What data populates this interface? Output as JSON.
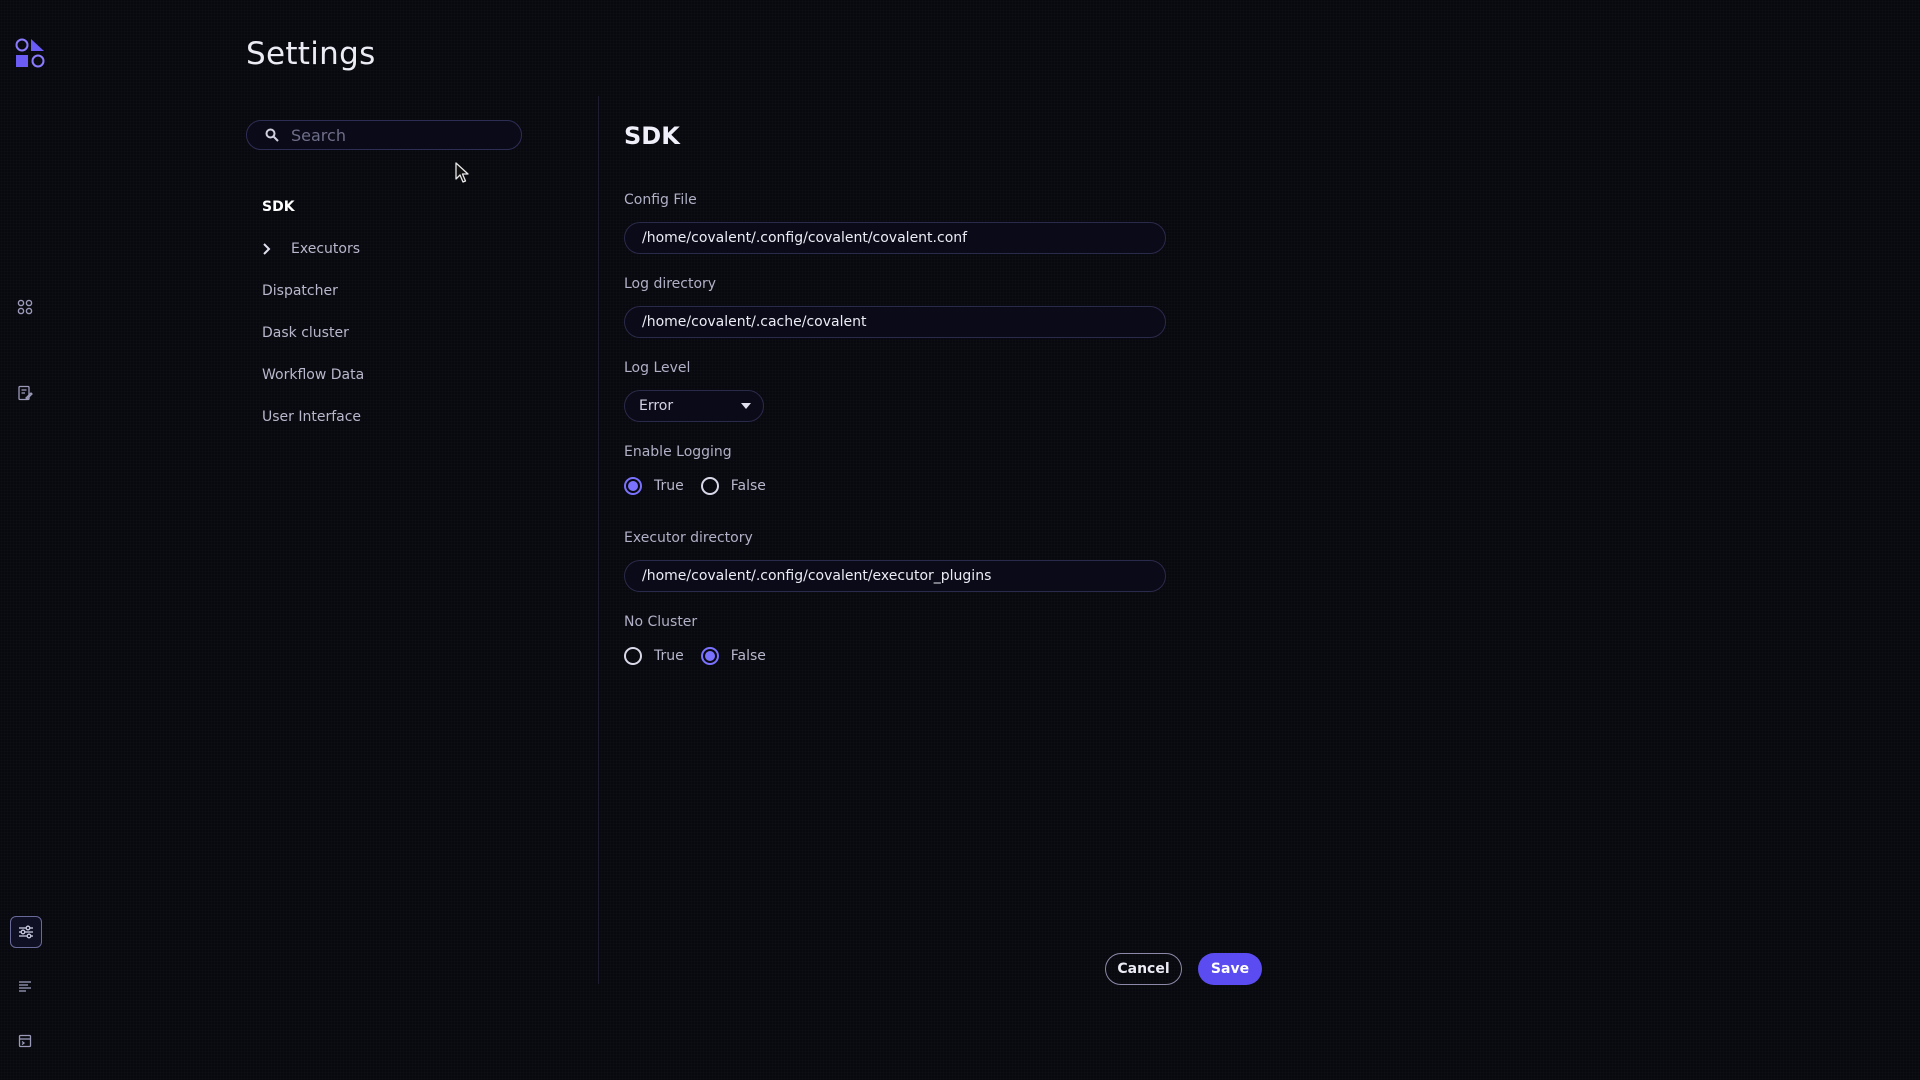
{
  "page": {
    "title": "Settings"
  },
  "search": {
    "placeholder": "Search"
  },
  "nav": {
    "items": [
      {
        "label": "SDK",
        "active": true,
        "expandable": false
      },
      {
        "label": "Executors",
        "active": false,
        "expandable": true
      },
      {
        "label": "Dispatcher",
        "active": false,
        "expandable": false
      },
      {
        "label": "Dask cluster",
        "active": false,
        "expandable": false
      },
      {
        "label": "Workflow Data",
        "active": false,
        "expandable": false
      },
      {
        "label": "User Interface",
        "active": false,
        "expandable": false
      }
    ]
  },
  "rail": {
    "icons": [
      "logo-icon",
      "dashboard-icon",
      "lattice-draft-icon",
      "settings-sliders-icon",
      "logs-icon",
      "terminal-icon"
    ]
  },
  "form": {
    "section_title": "SDK",
    "config_file": {
      "label": "Config File",
      "value": "/home/covalent/.config/covalent/covalent.conf"
    },
    "log_directory": {
      "label": "Log directory",
      "value": "/home/covalent/.cache/covalent"
    },
    "log_level": {
      "label": "Log Level",
      "value": "Error"
    },
    "enable_logging": {
      "label": "Enable Logging",
      "options": [
        "True",
        "False"
      ],
      "selected": "True"
    },
    "executor_directory": {
      "label": "Executor directory",
      "value": "/home/covalent/.config/covalent/executor_plugins"
    },
    "no_cluster": {
      "label": "No Cluster",
      "options": [
        "True",
        "False"
      ],
      "selected": "False"
    }
  },
  "actions": {
    "cancel_label": "Cancel",
    "save_label": "Save"
  },
  "colors": {
    "accent": "#5a4cf0",
    "radio_checked": "#7a72ff",
    "background": "#08080f"
  }
}
